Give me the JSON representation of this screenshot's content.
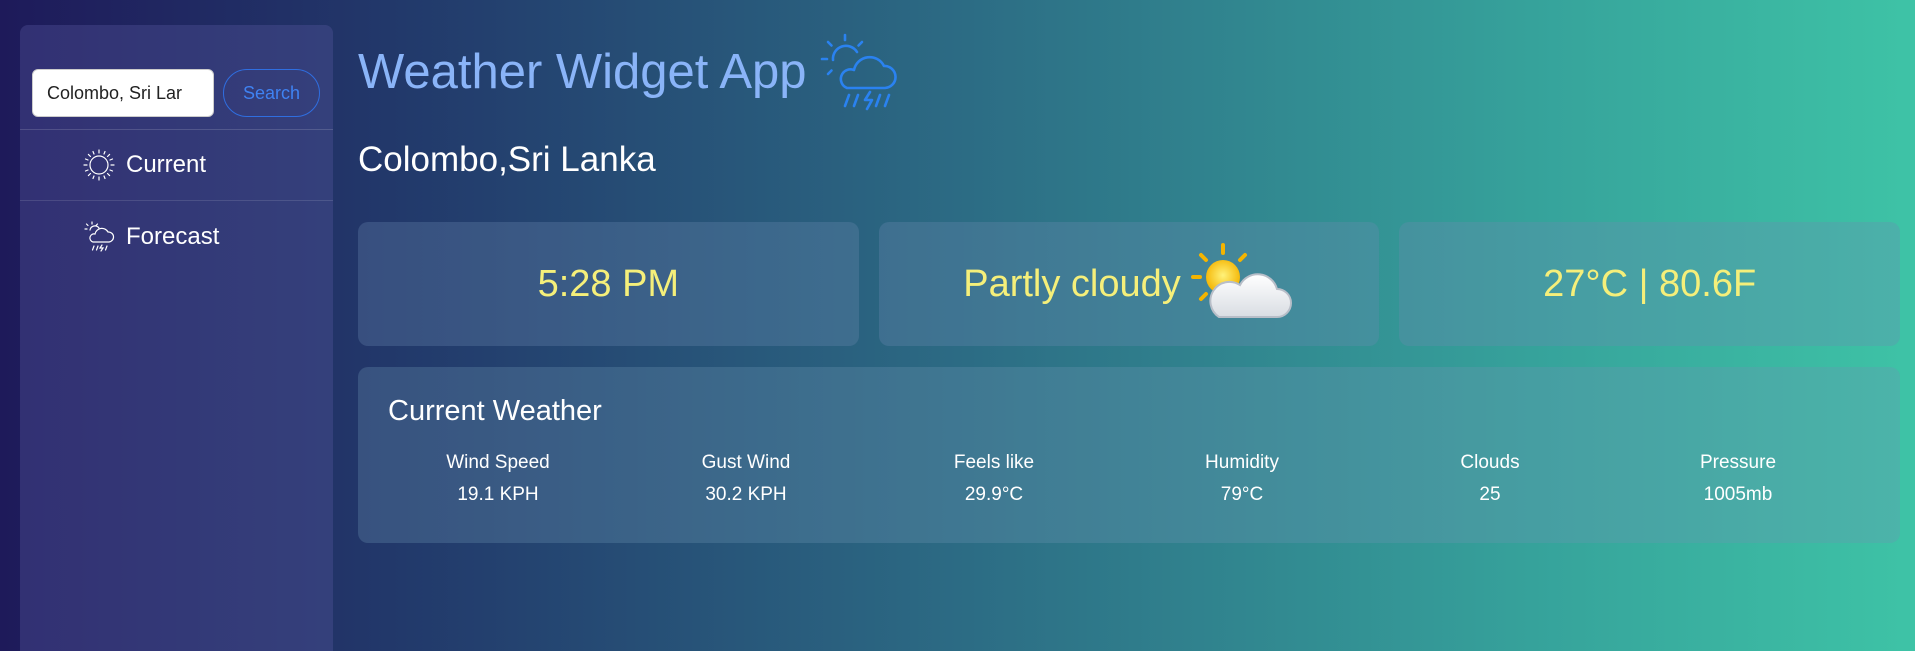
{
  "sidebar": {
    "search": {
      "value": "Colombo, Sri Lar",
      "placeholder": ""
    },
    "search_button": "Search",
    "items": [
      {
        "label": "Current",
        "icon": "sun-icon"
      },
      {
        "label": "Forecast",
        "icon": "cloud-sun-rain-icon"
      }
    ]
  },
  "header": {
    "title": "Weather Widget App",
    "icon": "cloud-sun-rain-icon",
    "title_color": "#8ab4f8"
  },
  "location": "Colombo,Sri Lanka",
  "cards": {
    "time": "5:28 PM",
    "condition": "Partly cloudy",
    "condition_icon": "partly-cloudy-icon",
    "temperature": "27°C | 80.6F",
    "text_color": "#f5ef7a"
  },
  "current_weather": {
    "title": "Current Weather",
    "metrics": [
      {
        "label": "Wind Speed",
        "value": "19.1 KPH"
      },
      {
        "label": "Gust Wind",
        "value": "30.2 KPH"
      },
      {
        "label": "Feels like",
        "value": "29.9°C"
      },
      {
        "label": "Humidity",
        "value": "79°C"
      },
      {
        "label": "Clouds",
        "value": "25"
      },
      {
        "label": "Pressure",
        "value": "1005mb"
      }
    ]
  }
}
